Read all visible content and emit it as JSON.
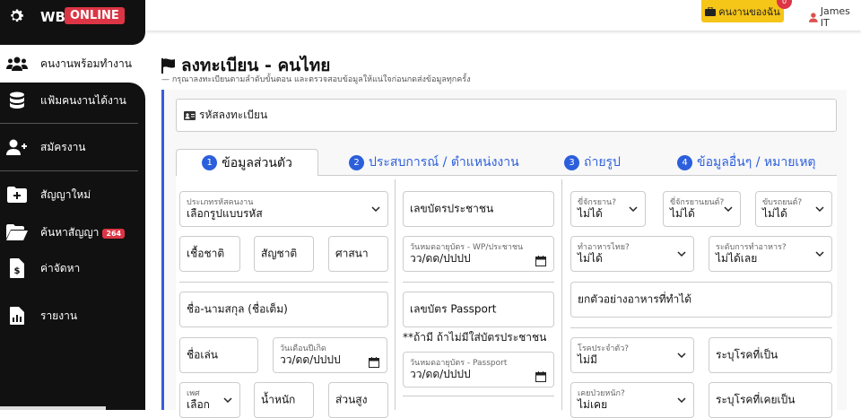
{
  "brand": {
    "wb": "WB",
    "online": "ONLINE"
  },
  "sidebar": {
    "items": [
      {
        "label": "คนงานพร้อมทำงาน",
        "icon": "users-icon"
      },
      {
        "label": "แฟ้มคนงานได้งาน",
        "icon": "database-icon"
      },
      {
        "label": "สมัครงาน",
        "icon": "user-plus-icon"
      },
      {
        "label": "สัญญาใหม่",
        "icon": "folder-plus-icon"
      },
      {
        "label": "ค้นหาสัญญา",
        "icon": "folder-open-icon",
        "badge": "264"
      },
      {
        "label": "ค่าจัดหา",
        "icon": "invoice-dollar-icon"
      },
      {
        "label": "รายงาน",
        "icon": "report-chart-icon"
      }
    ]
  },
  "topbar": {
    "jobs_label": "คนงานของฉัน",
    "jobs_count": "0",
    "user_name": "James IT"
  },
  "page": {
    "title": "ลงทะเบียน - คนไทย",
    "subtitle": "— กรุณาลงทะเบียนตามลำดับขั้นตอน และตรวจสอบข้อมูลให้แน่ใจก่อนกดส่งข้อมูลทุกครั้ง"
  },
  "reg_code_label": "รหัสลงทะเบียน",
  "tabs": [
    {
      "num": "1",
      "label": "ข้อมูลส่วนตัว"
    },
    {
      "num": "2",
      "label": "ประสบการณ์ / ตำแหน่งงาน"
    },
    {
      "num": "3",
      "label": "ถ่ายรูป"
    },
    {
      "num": "4",
      "label": "ข้อมูลอื่นๆ / หมายเหตุ"
    }
  ],
  "form": {
    "worker_code": {
      "label": "ประเภทรหัสคนงาน",
      "value": "เลือกรูปแบบรหัส"
    },
    "nationality": "เชื้อชาติ",
    "citizenship": "สัญชาติ",
    "religion": "ศาสนา",
    "full_name": "ชื่อ-นามสกุล (ชื่อเต็ม)",
    "nickname": "ชื่อเล่น",
    "birth_date": {
      "label": "วันเดือนปีเกิด",
      "value": "วว/ดด/ปปปป"
    },
    "gender": {
      "label": "เพศ",
      "value": "เลือก"
    },
    "weight": "น้ำหนัก",
    "height": "ส่วนสูง",
    "id_card": "เลขบัตรประชาชน",
    "id_expiry": {
      "label": "วันหมดอายุบัตร - WP/ประชาชน",
      "value": "วว/ดด/ปปปป"
    },
    "passport": "เลขบัตร Passport",
    "passport_note": "**ถ้ามี ถ้าไม่มีใส่บัตรประชาชน",
    "passport_expiry": {
      "label": "วันหมดอายุบัตร - Passport",
      "value": "วว/ดด/ปปปป"
    },
    "ride_bike": {
      "label": "ขี่จักรยาน?",
      "value": "ไม่ได้"
    },
    "ride_moto": {
      "label": "ขี่จักรยานยนต์?",
      "value": "ไม่ได้"
    },
    "drive_car": {
      "label": "ขับรถยนต์?",
      "value": "ไม่ได้"
    },
    "cook_thai": {
      "label": "ทำอาหารไทย?",
      "value": "ไม่ได้"
    },
    "cook_level": {
      "label": "ระดับการทำอาหาร?",
      "value": "ไม่ได้เลย"
    },
    "dishes": "ยกตัวอย่างอาหารที่ทำได้",
    "chronic": {
      "label": "โรคประจำตัว?",
      "value": "ไม่มี"
    },
    "disease_spec": "ระบุโรคที่เป็น",
    "past_illness": {
      "label": "เคยป่วยหนัก?",
      "value": "ไม่เคย"
    },
    "past_spec": "ระบุโรคที่เคยเป็น"
  }
}
